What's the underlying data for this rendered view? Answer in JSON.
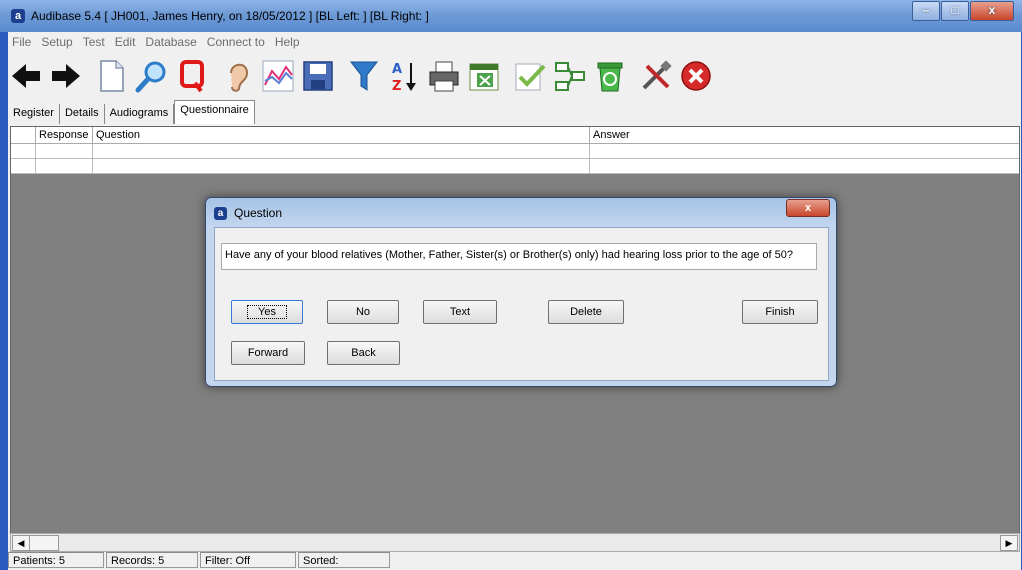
{
  "window": {
    "title": "Audibase 5.4 [ JH001, James Henry, on 18/05/2012 ] [BL Left:  ] [BL Right:  ]",
    "app_icon_letter": "a",
    "min_symbol": "–",
    "max_symbol": "□",
    "close_symbol": "x"
  },
  "menu": [
    "File",
    "Setup",
    "Test",
    "Edit",
    "Database",
    "Connect to",
    "Help"
  ],
  "toolbar": {
    "icons": [
      "back-arrow-icon",
      "forward-arrow-icon",
      "new-document-icon",
      "search-icon",
      "query-icon",
      "ear-icon",
      "chart-icon",
      "save-icon",
      "filter-icon",
      "sort-az-icon",
      "print-icon",
      "csv-export-icon",
      "check-icon",
      "tree-icon",
      "recycle-bin-icon",
      "tools-icon",
      "exit-icon"
    ]
  },
  "tabs": [
    "Register",
    "Details",
    "Audiograms",
    "Questionnaire"
  ],
  "grid": {
    "columns": [
      "Response",
      "Question",
      "Answer"
    ]
  },
  "status": {
    "patients": "Patients: 5",
    "records": "Records: 5",
    "filter": "Filter: Off",
    "sorted": "Sorted:"
  },
  "dialog": {
    "title": "Question",
    "icon_letter": "a",
    "close_symbol": "x",
    "question": "Have any of your blood relatives (Mother, Father, Sister(s) or Brother(s) only) had hearing loss prior to the age of 50?",
    "buttons": {
      "yes": "Yes",
      "no": "No",
      "text": "Text",
      "delete": "Delete",
      "finish": "Finish",
      "forward": "Forward",
      "back": "Back"
    }
  },
  "colors": {
    "title_bar": "#6e9bd6",
    "grid_background": "#808080"
  }
}
